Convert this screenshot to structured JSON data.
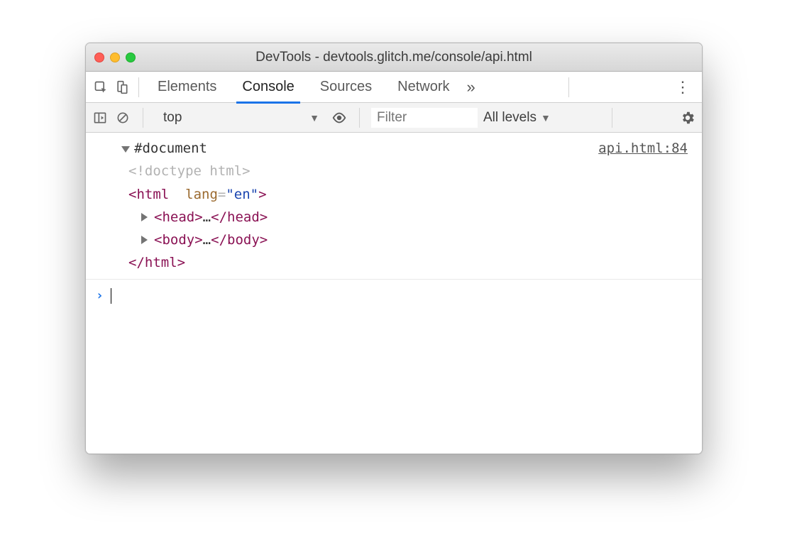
{
  "window": {
    "title": "DevTools - devtools.glitch.me/console/api.html"
  },
  "tabs": {
    "items": [
      {
        "label": "Elements"
      },
      {
        "label": "Console",
        "active": true
      },
      {
        "label": "Sources"
      },
      {
        "label": "Network"
      }
    ]
  },
  "filterbar": {
    "context": "top",
    "filter_placeholder": "Filter",
    "levels_label": "All levels"
  },
  "console": {
    "source_link": "api.html:84",
    "root_label": "#document",
    "doctype": "<!doctype html>",
    "html_open": {
      "tag": "html",
      "attr_name": "lang",
      "attr_eq": "=",
      "attr_val": "\"en\""
    },
    "head": {
      "tag": "head",
      "ellipsis": "…"
    },
    "body": {
      "tag": "body",
      "ellipsis": "…"
    },
    "html_close_tag": "html"
  }
}
